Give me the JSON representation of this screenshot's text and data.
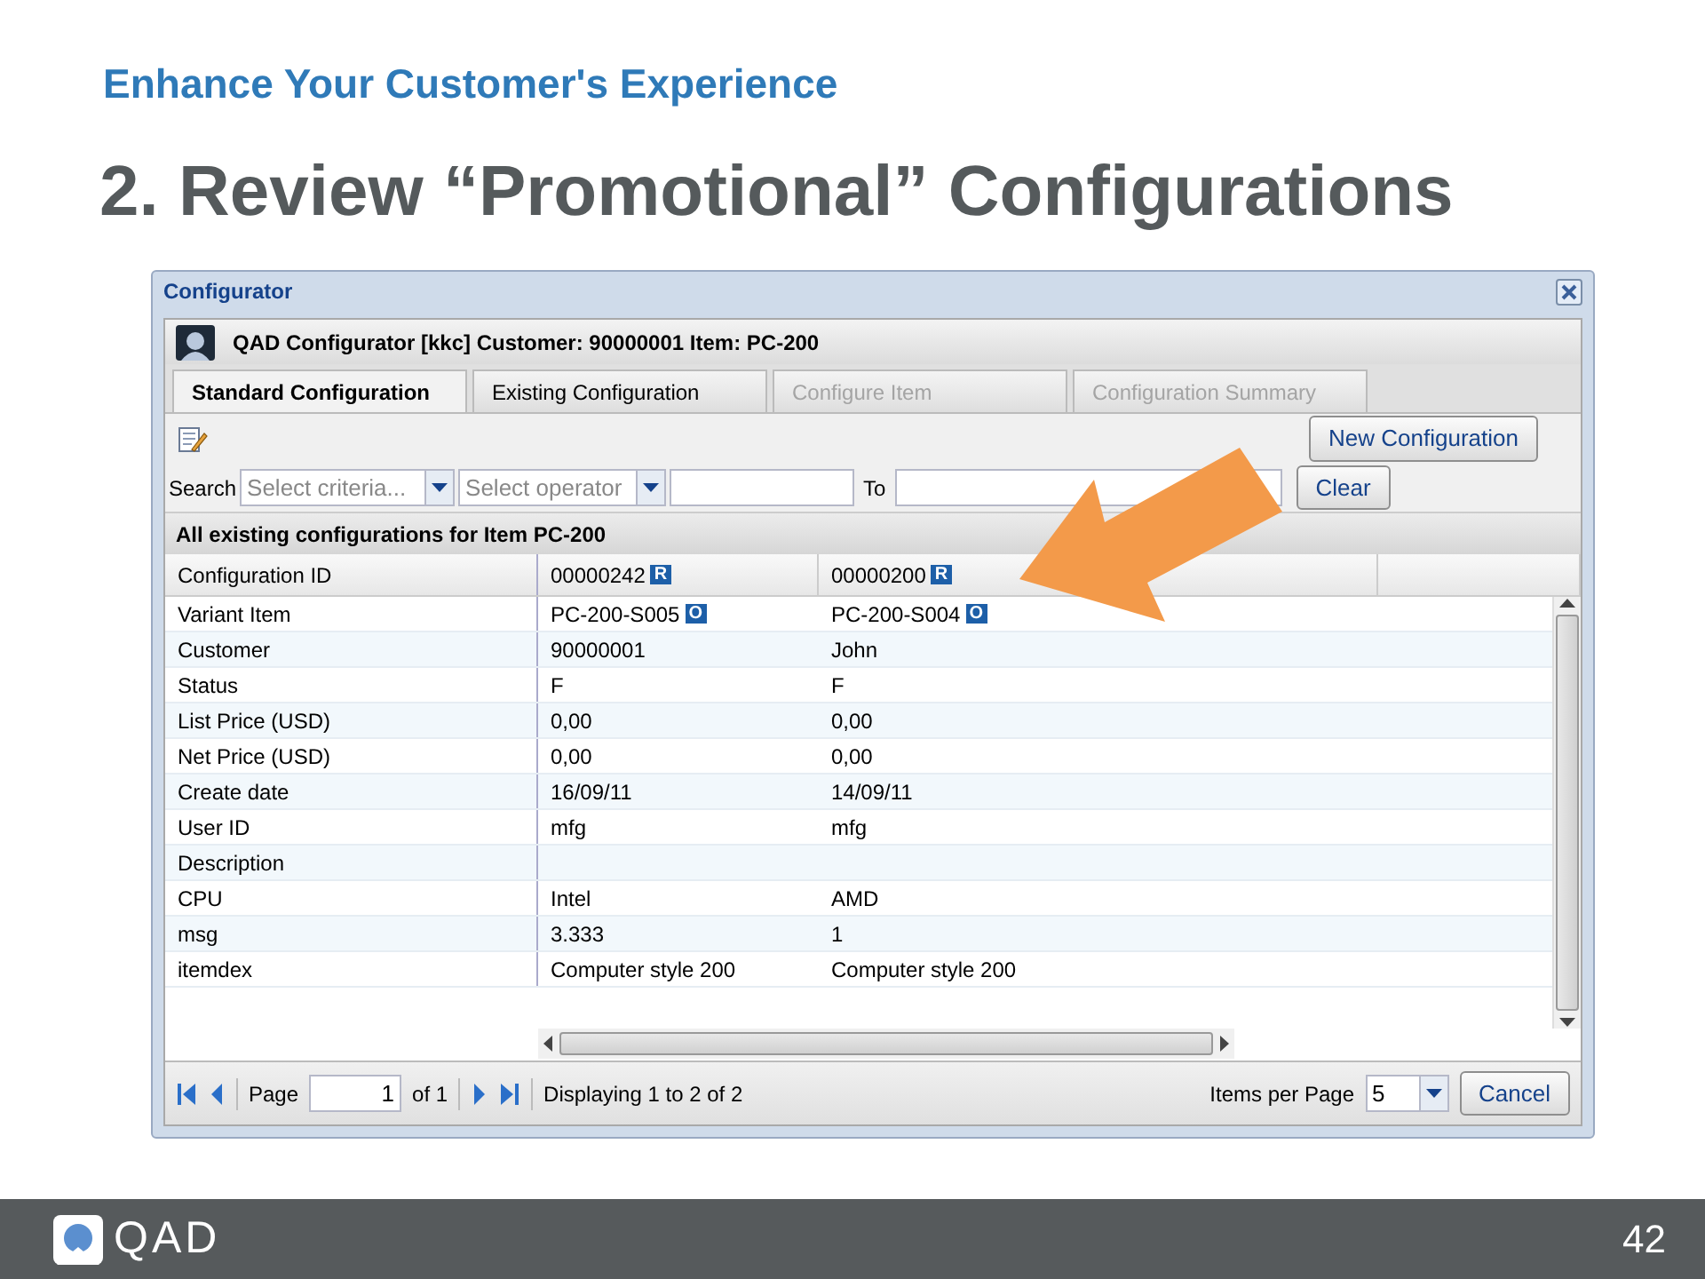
{
  "slide": {
    "subtitle": "Enhance Your Customer's Experience",
    "title": "2. Review “Promotional” Configurations",
    "logo_text": "QAD",
    "page_number": "42"
  },
  "window": {
    "title": "Configurator",
    "header": "QAD Configurator [kkc] Customer: 90000001 Item: PC-200"
  },
  "tabs": [
    {
      "label": "Standard Configuration",
      "selected": true,
      "disabled": false
    },
    {
      "label": "Existing Configuration",
      "selected": false,
      "disabled": false
    },
    {
      "label": "Configure Item",
      "selected": false,
      "disabled": true
    },
    {
      "label": "Configuration Summary",
      "selected": false,
      "disabled": true
    }
  ],
  "toolbar": {
    "new_button": "New Configuration"
  },
  "search": {
    "label": "Search",
    "criteria_placeholder": "Select criteria...",
    "operator_placeholder": "Select operator",
    "to_label": "To",
    "clear_button": "Clear"
  },
  "grid": {
    "title": "All existing configurations for Item PC-200",
    "header": {
      "label": "Configuration ID",
      "values": [
        {
          "text": "00000242",
          "badge": "R"
        },
        {
          "text": "00000200",
          "badge": "R"
        }
      ]
    },
    "rows": [
      {
        "label": "Variant Item",
        "values": [
          {
            "text": "PC-200-S005",
            "badge": "O"
          },
          {
            "text": "PC-200-S004",
            "badge": "O"
          }
        ]
      },
      {
        "label": "Customer",
        "values": [
          {
            "text": "90000001"
          },
          {
            "text": "John"
          }
        ]
      },
      {
        "label": "Status",
        "values": [
          {
            "text": "F"
          },
          {
            "text": "F"
          }
        ]
      },
      {
        "label": "List Price (USD)",
        "values": [
          {
            "text": "0,00"
          },
          {
            "text": "0,00"
          }
        ]
      },
      {
        "label": "Net Price (USD)",
        "values": [
          {
            "text": "0,00"
          },
          {
            "text": "0,00"
          }
        ]
      },
      {
        "label": "Create date",
        "values": [
          {
            "text": "16/09/11"
          },
          {
            "text": "14/09/11"
          }
        ]
      },
      {
        "label": "User ID",
        "values": [
          {
            "text": "mfg"
          },
          {
            "text": "mfg"
          }
        ]
      },
      {
        "label": "Description",
        "values": []
      },
      {
        "label": "CPU",
        "values": [
          {
            "text": "Intel"
          },
          {
            "text": "AMD"
          }
        ]
      },
      {
        "label": "msg",
        "values": [
          {
            "text": "3.333"
          },
          {
            "text": "1"
          }
        ]
      },
      {
        "label": "itemdex",
        "values": [
          {
            "text": "Computer style 200"
          },
          {
            "text": "Computer style 200"
          }
        ]
      }
    ]
  },
  "paging": {
    "page_label": "Page",
    "page_value": "1",
    "of_label": "of 1",
    "displaying": "Displaying 1 to 2 of 2",
    "items_label": "Items per Page",
    "items_value": "5",
    "cancel_button": "Cancel"
  }
}
